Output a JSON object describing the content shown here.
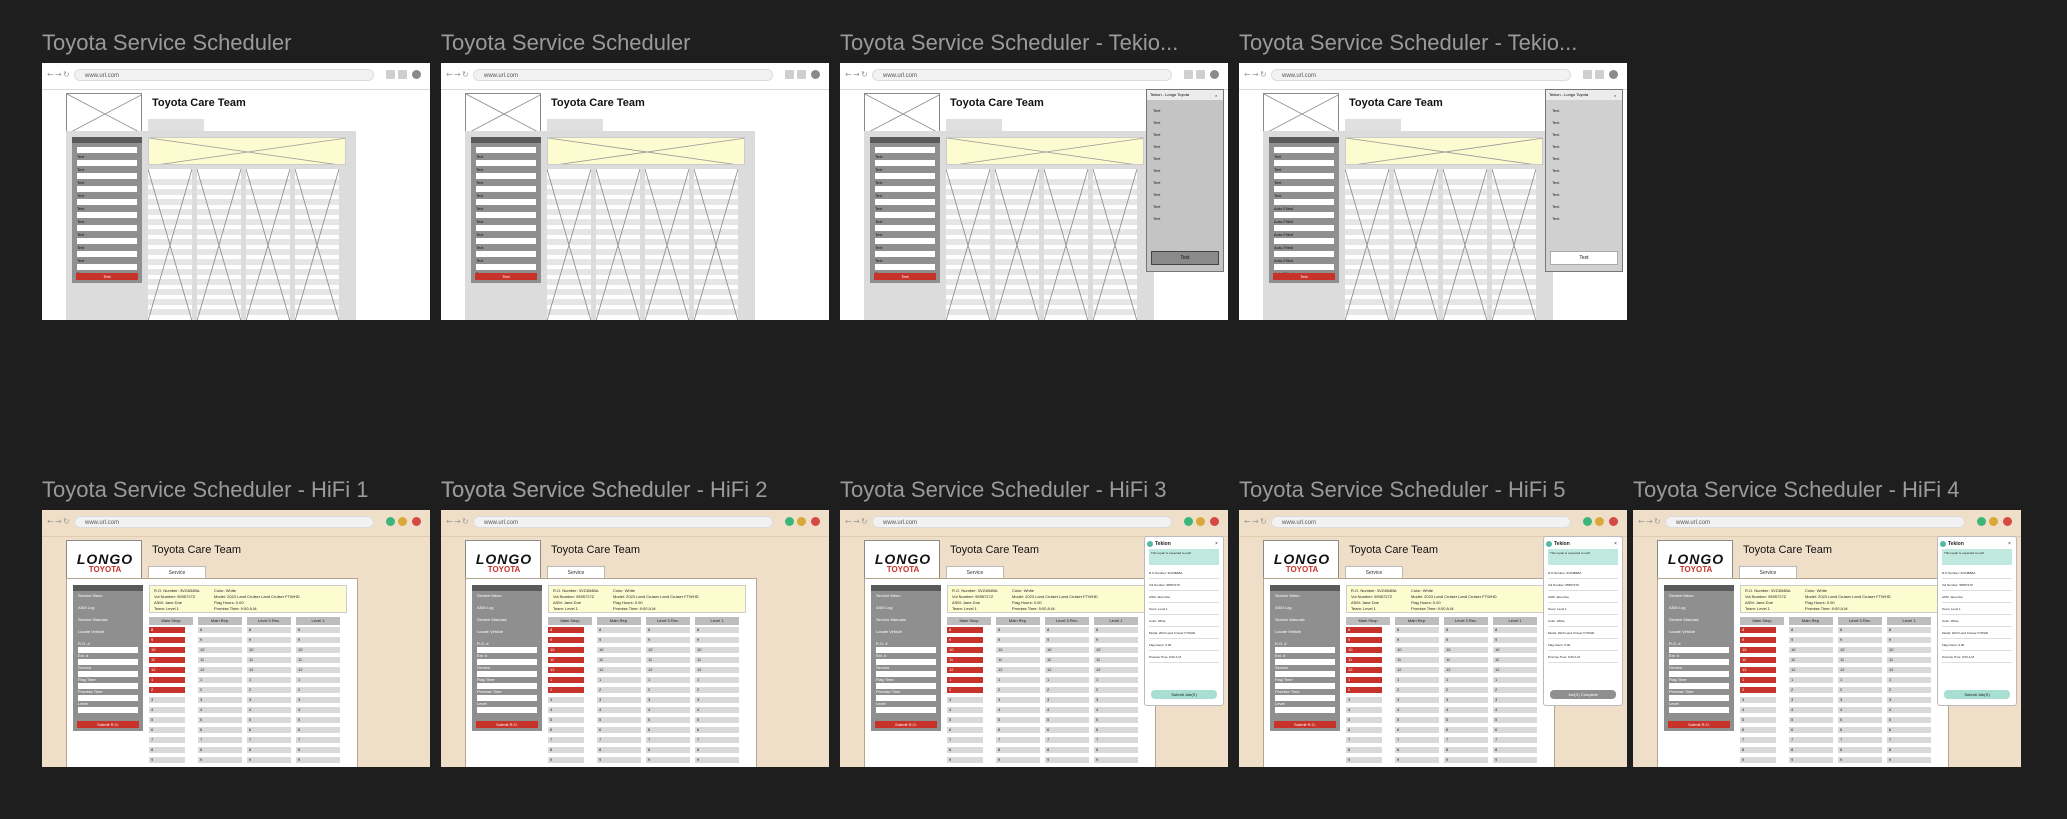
{
  "browser": {
    "url": "www.url.com"
  },
  "logo": {
    "line1": "LONGO",
    "line2": "TOYOTA"
  },
  "frames": [
    {
      "title": "Toyota Service Scheduler",
      "kind": "lofi",
      "team": "Toyota Care Team"
    },
    {
      "title": "Toyota Service Scheduler",
      "kind": "lofi",
      "team": "Toyota Care Team"
    },
    {
      "title": "Toyota Service Scheduler - Tekio...",
      "kind": "lofi",
      "team": "Toyota Care Team"
    },
    {
      "title": "Toyota Service Scheduler - Tekio...",
      "kind": "lofi",
      "team": "Toyota Care Team"
    },
    {
      "title": "Toyota Service Scheduler - HiFi 1",
      "kind": "hifi",
      "team": "Toyota Care Team"
    },
    {
      "title": "Toyota Service Scheduler - HiFi 2",
      "kind": "hifi",
      "team": "Toyota Care Team"
    },
    {
      "title": "Toyota Service Scheduler - HiFi 3",
      "kind": "hifi",
      "team": "Toyota Care Team"
    },
    {
      "title": "Toyota Service Scheduler - HiFi 5",
      "kind": "hifi",
      "team": "Toyota Care Team"
    },
    {
      "title": "Toyota Service Scheduler - HiFi 4",
      "kind": "hifi",
      "team": "Toyota Care Team"
    }
  ],
  "overlap_title": "Toyota Service Scheduler",
  "lofi": {
    "submit": "Text",
    "panel_title_a": "Tekion - Longo Toyota",
    "panel_title_b": "Tekion - Longo Toyota",
    "panel_item": "Text",
    "panel_button": "Text",
    "filled_value": "Auto-Filled"
  },
  "hifi": {
    "tab": "Service",
    "sidebar_labels": [
      "Service Menu",
      "ASM Log",
      "Service Manuals",
      "Locate Vehicle",
      "R.O. #",
      "Ext. #",
      "Service",
      "Flag Time",
      "Promise Time",
      "Level"
    ],
    "submit": "Submit R.O.",
    "ro": {
      "number": "R.O. Number: 3VZ4B4BA",
      "vin": "Vol Number: 9595727Z",
      "asm": "ASM: Jane Doe",
      "team": "Team: Level 1",
      "color": "Color: White",
      "model": "Model: 2023 Land Cruiser Land Cruiser FTWHD",
      "flag": "Flag Hours: 0.00",
      "promise": "Promise Time: 9:00 A.M."
    },
    "grid_headers": [
      "Main Shop",
      "Main Rep.",
      "Level 3 Rec.",
      "Level 1"
    ],
    "row_numbers": [
      "8",
      "9",
      "10",
      "11",
      "12",
      "1",
      "2",
      "3",
      "4",
      "5",
      "6",
      "7",
      "8",
      "9"
    ],
    "panel_title": "Tekion",
    "panel_msg": "This repair is expected to end!",
    "panel_rows": [
      "R.O Number: 3VZ4B4BA",
      "Vol Number: 9595727Z",
      "ASM: Jane Doe",
      "Team: Level 1",
      "Color: White",
      "Model: 2023 Land Cruiser FTWHD",
      "Flag Hours: 0.00",
      "Promise Time: 9:00 A.M."
    ],
    "panel_btn_submit": "Submit Job(X)",
    "panel_btn_complete": "Job(X) Complete"
  }
}
